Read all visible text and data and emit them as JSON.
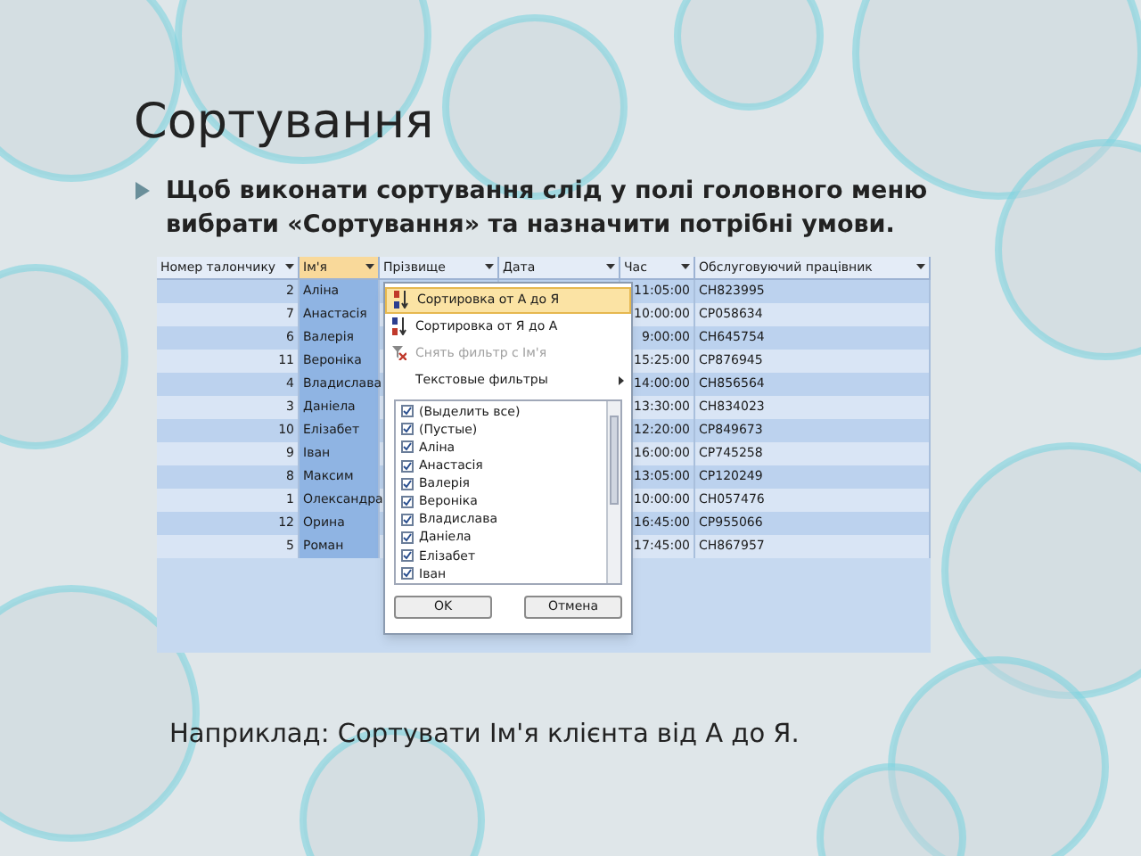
{
  "slide": {
    "title": "Сортування",
    "bullet": "Щоб виконати сортування слід у полі головного меню вибрати «Сортування» та назначити потрібні умови.",
    "caption": "Наприклад: Сортувати Ім'я клієнта від А до Я."
  },
  "table": {
    "columns": [
      {
        "label": "Номер талончику",
        "selected": false
      },
      {
        "label": "Ім'я",
        "selected": true
      },
      {
        "label": "Прізвище",
        "selected": false
      },
      {
        "label": "Дата",
        "selected": false
      },
      {
        "label": "Час",
        "selected": false
      },
      {
        "label": "Обслуговуючий працівник",
        "selected": false
      }
    ],
    "rows": [
      {
        "number": "2",
        "name": "Аліна",
        "time": "11:05:00",
        "worker": "CH823995"
      },
      {
        "number": "7",
        "name": "Анастасія",
        "time": "10:00:00",
        "worker": "CP058634"
      },
      {
        "number": "6",
        "name": "Валерія",
        "time": "9:00:00",
        "worker": "CH645754"
      },
      {
        "number": "11",
        "name": "Вероніка",
        "time": "15:25:00",
        "worker": "CP876945"
      },
      {
        "number": "4",
        "name": "Владислава",
        "time": "14:00:00",
        "worker": "CH856564"
      },
      {
        "number": "3",
        "name": "Даніела",
        "time": "13:30:00",
        "worker": "CH834023"
      },
      {
        "number": "10",
        "name": "Елізабет",
        "time": "12:20:00",
        "worker": "CP849673"
      },
      {
        "number": "9",
        "name": "Іван",
        "time": "16:00:00",
        "worker": "CP745258"
      },
      {
        "number": "8",
        "name": "Максим",
        "time": "13:05:00",
        "worker": "CP120249"
      },
      {
        "number": "1",
        "name": "Олександра",
        "time": "10:00:00",
        "worker": "CH057476"
      },
      {
        "number": "12",
        "name": "Орина",
        "time": "16:45:00",
        "worker": "CP955066"
      },
      {
        "number": "5",
        "name": "Роман",
        "time": "17:45:00",
        "worker": "CH867957"
      }
    ]
  },
  "filter_menu": {
    "items": [
      {
        "kind": "sort-asc",
        "label": "Сортировка от А до Я",
        "selected": true,
        "disabled": false
      },
      {
        "kind": "sort-desc",
        "label": "Сортировка от Я до А",
        "selected": false,
        "disabled": false
      },
      {
        "kind": "clear-filter",
        "label": "Снять фильтр с Ім'я",
        "selected": false,
        "disabled": true
      },
      {
        "kind": "submenu",
        "label": "Текстовые фильтры",
        "selected": false,
        "disabled": false
      }
    ],
    "values": [
      {
        "label": "(Выделить все)",
        "checked": true
      },
      {
        "label": "(Пустые)",
        "checked": true
      },
      {
        "label": "Аліна",
        "checked": true
      },
      {
        "label": "Анастасія",
        "checked": true
      },
      {
        "label": "Валерія",
        "checked": true
      },
      {
        "label": "Вероніка",
        "checked": true
      },
      {
        "label": "Владислава",
        "checked": true
      },
      {
        "label": "Даніела",
        "checked": true
      },
      {
        "label": "Елізабет",
        "checked": true
      },
      {
        "label": "Іван",
        "checked": true
      }
    ],
    "buttons": [
      "OK",
      "Отмена"
    ]
  }
}
